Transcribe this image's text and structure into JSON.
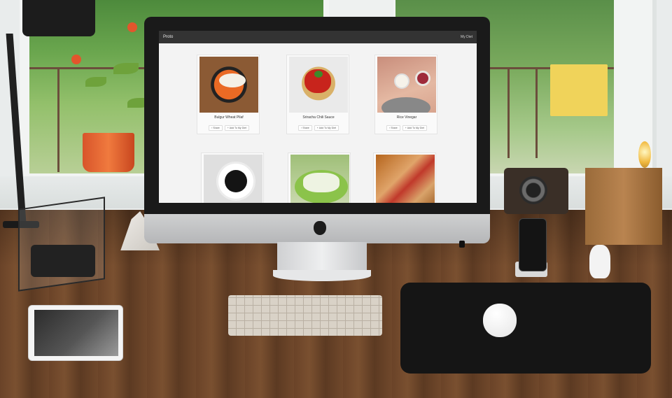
{
  "app": {
    "brand": "Proto",
    "nav_link": "My Diet"
  },
  "icons": {
    "share": "share-icon",
    "add": "plus-icon"
  },
  "cards": [
    {
      "title": "Bulgur Wheat Pilaf",
      "share_label": "Share",
      "add_label": "+ Add To My Diet"
    },
    {
      "title": "Sriracha Chili Sauce",
      "share_label": "Share",
      "add_label": "+ Add To My Diet"
    },
    {
      "title": "Rice Vinegar",
      "share_label": "Share",
      "add_label": "+ Add To My Diet"
    },
    {
      "title": "",
      "share_label": "",
      "add_label": ""
    },
    {
      "title": "",
      "share_label": "",
      "add_label": ""
    },
    {
      "title": "",
      "share_label": "",
      "add_label": ""
    }
  ],
  "colors": {
    "navbar": "#333333",
    "screen_bg": "#f3f3f3"
  }
}
